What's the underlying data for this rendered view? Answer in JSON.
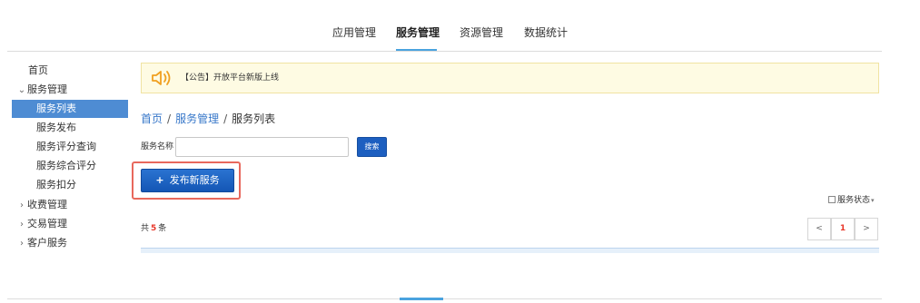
{
  "colors": {
    "accent_blue": "#1d5fc0",
    "link_blue": "#3777c9",
    "sidebar_active": "#4e8cd3",
    "notice_bg": "#fefbe3",
    "highlight_red": "#e8685c",
    "count_red": "#e8382b"
  },
  "topnav": {
    "items": [
      {
        "label": "应用管理",
        "active": false
      },
      {
        "label": "服务管理",
        "active": true
      },
      {
        "label": "资源管理",
        "active": false
      },
      {
        "label": "数据统计",
        "active": false
      }
    ]
  },
  "sidebar": {
    "items": [
      {
        "label": "首页",
        "level": 0,
        "arrow": ""
      },
      {
        "label": "服务管理",
        "level": 0,
        "arrow": "⌄"
      },
      {
        "label": "服务列表",
        "level": 1,
        "active": true
      },
      {
        "label": "服务发布",
        "level": 1
      },
      {
        "label": "服务评分查询",
        "level": 1
      },
      {
        "label": "服务综合评分",
        "level": 1
      },
      {
        "label": "服务扣分",
        "level": 1
      },
      {
        "label": "收费管理",
        "level": 0,
        "arrow": "›"
      },
      {
        "label": "交易管理",
        "level": 0,
        "arrow": "›"
      },
      {
        "label": "客户服务",
        "level": 0,
        "arrow": "›"
      }
    ]
  },
  "notice": {
    "icon": "speaker-icon",
    "text": "【公告】开放平台新版上线"
  },
  "breadcrumb": {
    "home": "首页",
    "sep1": "/",
    "section": "服务管理",
    "sep2": "/",
    "current": "服务列表"
  },
  "search": {
    "label": "服务名称",
    "value": "",
    "placeholder": "",
    "button_label": "搜索"
  },
  "publish_button": {
    "icon": "plus-icon",
    "plus": "+",
    "label": "发布新服务"
  },
  "status_filter": {
    "label": "服务状态",
    "caret": "▾"
  },
  "total": {
    "prefix": "共",
    "count": "5",
    "suffix": "条"
  },
  "pager": {
    "prev": "<",
    "page": "1",
    "next": ">"
  }
}
